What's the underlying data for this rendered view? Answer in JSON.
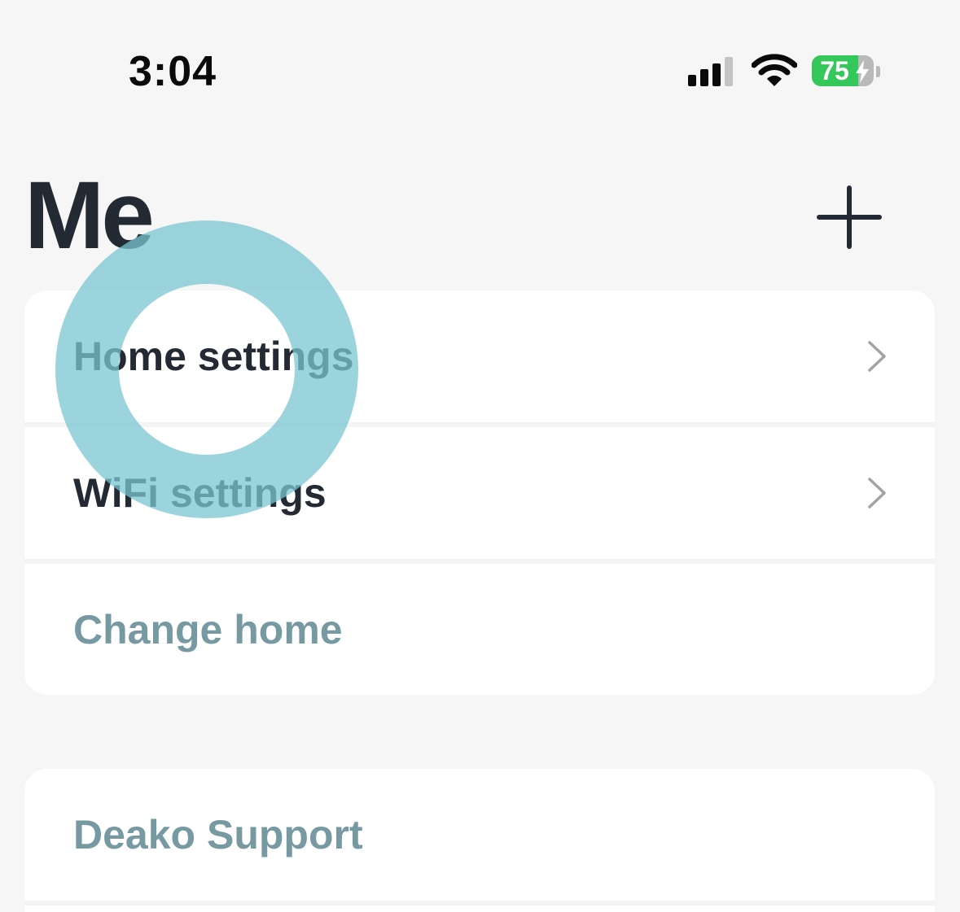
{
  "status_bar": {
    "time": "3:04",
    "battery_level": "75",
    "battery_charging": true,
    "signal_icon": "cellular-signal-icon",
    "wifi_icon": "wifi-icon",
    "battery_icon": "battery-charging-icon"
  },
  "header": {
    "title": "Me",
    "add_icon": "plus-icon"
  },
  "settings_list": {
    "items": [
      {
        "label": "Home settings",
        "has_chevron": true,
        "style": "primary"
      },
      {
        "label": "WiFi settings",
        "has_chevron": true,
        "style": "primary"
      },
      {
        "label": "Change home",
        "has_chevron": false,
        "style": "muted"
      }
    ]
  },
  "support_list": {
    "items": [
      {
        "label": "Deako Support",
        "has_chevron": false,
        "style": "muted"
      }
    ]
  },
  "colors": {
    "background": "#f6f6f6",
    "card": "#ffffff",
    "text_primary": "#232a33",
    "text_muted": "#779aa2",
    "chevron": "#a3a3a3",
    "battery_green": "#34c759",
    "touch_ring": "#7ac6d2"
  }
}
